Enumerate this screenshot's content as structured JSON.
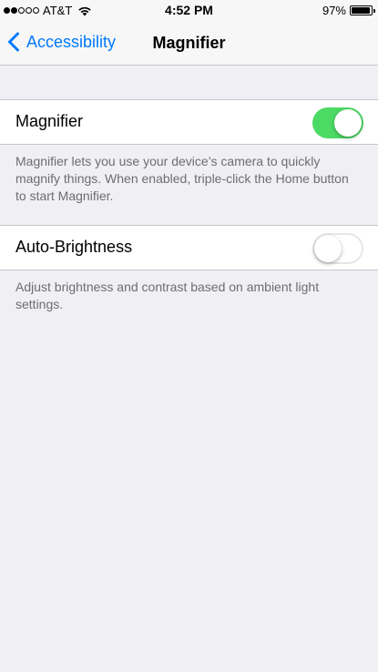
{
  "status_bar": {
    "carrier": "AT&T",
    "time": "4:52 PM",
    "battery": "97%",
    "battery_level": 0.97,
    "signal_bars_filled": 2,
    "signal_bars_total": 5
  },
  "nav": {
    "back_label": "Accessibility",
    "title": "Magnifier",
    "accent_color": "#007aff"
  },
  "magnifier": {
    "label": "Magnifier",
    "enabled": true,
    "footer": "Magnifier lets you use your device’s camera to quickly magnify things. When enabled, triple-click the Home button to start Magnifier."
  },
  "auto_brightness": {
    "label": "Auto-Brightness",
    "enabled": false,
    "footer": "Adjust brightness and contrast based on ambient light settings."
  },
  "colors": {
    "toggle_on": "#4cd964",
    "background": "#efeff4"
  }
}
